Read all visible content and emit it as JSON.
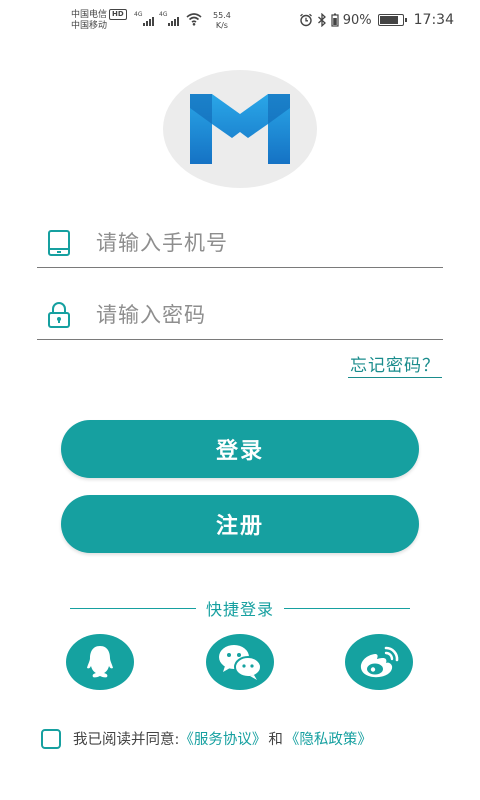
{
  "status_bar": {
    "carrier_line1": "中国电信",
    "hd": "HD",
    "carrier_line2": "中国移动",
    "net1": "4G",
    "net2": "4G",
    "speed_value": "55.4",
    "speed_unit": "K/s",
    "battery_percent": "90%",
    "battery_level": 0.9,
    "time": "17:34"
  },
  "login": {
    "phone_placeholder": "请输入手机号",
    "password_placeholder": "请输入密码",
    "forgot_label": "忘记密码？",
    "login_label": "登录",
    "register_label": "注册"
  },
  "quick_login": {
    "title": "快捷登录",
    "providers": [
      {
        "name": "qq",
        "icon": "qq-icon"
      },
      {
        "name": "wechat",
        "icon": "wechat-icon"
      },
      {
        "name": "weibo",
        "icon": "weibo-icon"
      }
    ]
  },
  "agreement": {
    "prefix": "我已阅读并同意:",
    "terms_link": "《服务协议》",
    "and": "和",
    "privacy_link": "《隐私政策》"
  },
  "colors": {
    "accent": "#16a0a0",
    "logo_bg": "#ececec",
    "logo_blue": "#1e8ad6"
  }
}
